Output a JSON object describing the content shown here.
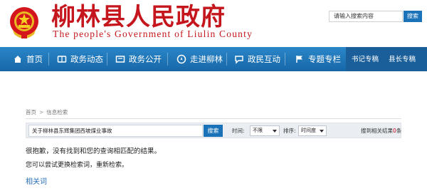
{
  "header": {
    "title": "柳林县人民政府",
    "subtitle": "The people's Government of Liulin County",
    "search_placeholder": "请输入搜索内容",
    "search_button": "搜索"
  },
  "nav": {
    "items": [
      {
        "label": "首页",
        "icon": "home-icon"
      },
      {
        "label": "政务动态",
        "icon": "news-icon"
      },
      {
        "label": "政务公开",
        "icon": "folder-icon"
      },
      {
        "label": "走进柳林",
        "icon": "compass-icon"
      },
      {
        "label": "政民互动",
        "icon": "chat-icon"
      },
      {
        "label": "专题专栏",
        "icon": "flag-icon"
      }
    ],
    "right_items": [
      "书记专稿",
      "县长专稿"
    ]
  },
  "breadcrumb": {
    "home": "首页",
    "current": "信息检索",
    "separator": ">"
  },
  "search": {
    "query": "关于柳林县东辉集团西坡煤业事故",
    "button": "搜索",
    "time_label": "时间:",
    "time_value": "不限",
    "sort_label": "排序:",
    "sort_value": "时间度",
    "result_prefix": "搜到相关结果",
    "result_count": "0",
    "result_suffix": "条"
  },
  "messages": {
    "line1": "很抱歉，没有找到和您的查询相匹配的结果。",
    "line2": "您可以尝试更换检索词，重新检索。",
    "related": "相关词"
  },
  "colors": {
    "brand_red": "#c4161c",
    "nav_blue": "#1e74b8",
    "button_blue": "#1a72b8",
    "link_blue": "#2a6fb5"
  }
}
